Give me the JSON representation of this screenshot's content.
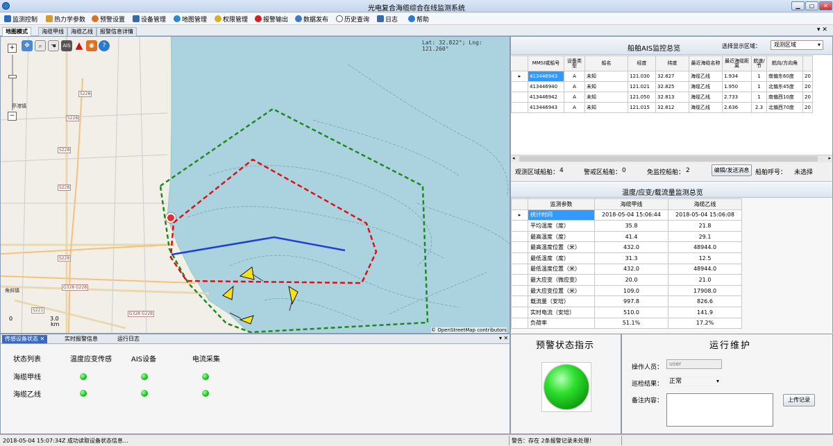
{
  "window": {
    "title": "光电复合海缆综合在线监测系统",
    "min": "▁",
    "max": "▢",
    "close": "✕"
  },
  "menu": [
    {
      "label": "监测控制",
      "icon": "monitor-icon",
      "color": "#2b6cc4"
    },
    {
      "label": "热力学参数",
      "icon": "thermo-icon",
      "color": "#d89b2a"
    },
    {
      "label": "预警设置",
      "icon": "alert-icon",
      "color": "#e07020"
    },
    {
      "label": "设备管理",
      "icon": "device-icon",
      "color": "#3a6aa8"
    },
    {
      "label": "地图管理",
      "icon": "map-icon",
      "color": "#2a8ad0"
    },
    {
      "label": "权限管理",
      "icon": "key-icon",
      "color": "#d8b020"
    },
    {
      "label": "报警输出",
      "icon": "alarm-icon",
      "color": "#d02020"
    },
    {
      "label": "数据发布",
      "icon": "publish-icon",
      "color": "#3a7ac8"
    },
    {
      "label": "历史查询",
      "icon": "clock-icon",
      "color": "#555555"
    },
    {
      "label": "日志",
      "icon": "log-icon",
      "color": "#3a6aa8"
    },
    {
      "label": "帮助",
      "icon": "help-icon",
      "color": "#2a7ad0"
    }
  ],
  "tabs": [
    "地图模式",
    "海缆甲线",
    "海缆乙线",
    "报警信息详情"
  ],
  "map": {
    "coords": "Lat: 32.822°; Lng: 121.260°",
    "attribution": "© OpenStreetMap contributors",
    "scale_left": "0",
    "scale_mid": "3.0",
    "scale_unit": "km",
    "places": [
      "亭港镇",
      "角斜镇"
    ],
    "roads": [
      "S228",
      "S228",
      "S228",
      "S228",
      "S228",
      "G328 G228",
      "S221",
      "G328 G228"
    ]
  },
  "ais": {
    "title": "船舶AIS监控总览",
    "area_label": "选择显示区域：",
    "area_value": "观测区域",
    "columns": [
      "MMSI或船号",
      "设备类型",
      "船名",
      "经度",
      "纬度",
      "最近海缆名称",
      "最近海缆距离",
      "航速/节",
      "航向/方向角"
    ],
    "rows": [
      [
        "413446943",
        "A",
        "未知",
        "121.030",
        "32.827",
        "海缆乙线",
        "1.934",
        "1",
        "南偏东60度",
        "20"
      ],
      [
        "413446940",
        "A",
        "未知",
        "121.021",
        "32.825",
        "海缆乙线",
        "1.950",
        "1",
        "北偏东45度",
        "20"
      ],
      [
        "413446942",
        "A",
        "未知",
        "121.050",
        "32.813",
        "海缆乙线",
        "2.733",
        "1",
        "南偏西10度",
        "20"
      ],
      [
        "413446943",
        "A",
        "未知",
        "121.015",
        "32.812",
        "海缆乙线",
        "2.636",
        "2.3",
        "北偏西70度",
        "20"
      ]
    ],
    "obs_label": "观测区域船舶：",
    "obs_count": "4",
    "warn_label": "警戒区船舶：",
    "warn_count": "0",
    "exempt_label": "免监控船舶：",
    "exempt_count": "2",
    "edit_button": "编辑/发送消息",
    "call_label": "船舶呼号：",
    "call_value": "未选择"
  },
  "temp": {
    "title": "温度/应变/载流量监测总览",
    "col_param": "监测参数",
    "col_a": "海缆甲线",
    "col_b": "海缆乙线",
    "rows": [
      [
        "统计时间",
        "2018-05-04 15:06:44",
        "2018-05-04 15:06:08"
      ],
      [
        "平均温度（度）",
        "35.8",
        "21.8"
      ],
      [
        "最高温度（度）",
        "41.4",
        "29.1"
      ],
      [
        "最高温度位置（米）",
        "432.0",
        "48944.0"
      ],
      [
        "最低温度（度）",
        "31.3",
        "12.5"
      ],
      [
        "最低温度位置（米）",
        "432.0",
        "48944.0"
      ],
      [
        "最大应变（微应变）",
        "20.0",
        "21.0"
      ],
      [
        "最大应变位置（米）",
        "109.0",
        "17908.0"
      ],
      [
        "载流量（安培）",
        "997.8",
        "826.6"
      ],
      [
        "实时电流（安培）",
        "510.0",
        "141.9"
      ],
      [
        "负荷率",
        "51.1%",
        "17.2%"
      ]
    ]
  },
  "bottom": {
    "tabs": [
      "传感设备状态",
      "实时报警信息",
      "运行日志"
    ],
    "headers": [
      "状态列表",
      "温度应变传感",
      "AIS设备",
      "电流采集"
    ],
    "rows": [
      "海缆甲线",
      "海缆乙线"
    ]
  },
  "warning": {
    "title": "预警状态指示",
    "status_color": "#1ec81e"
  },
  "maintenance": {
    "title": "运行维护",
    "operator_label": "操作人员：",
    "operator_value": "user",
    "result_label": "巡检结果：",
    "result_value": "正常",
    "note_label": "备注内容：",
    "upload_button": "上传记录"
  },
  "status": {
    "left": "2018-05-04 15:07:34Z  成功读取设备状态信息...",
    "right": "警告：存在 2条报警记录未处理！"
  }
}
